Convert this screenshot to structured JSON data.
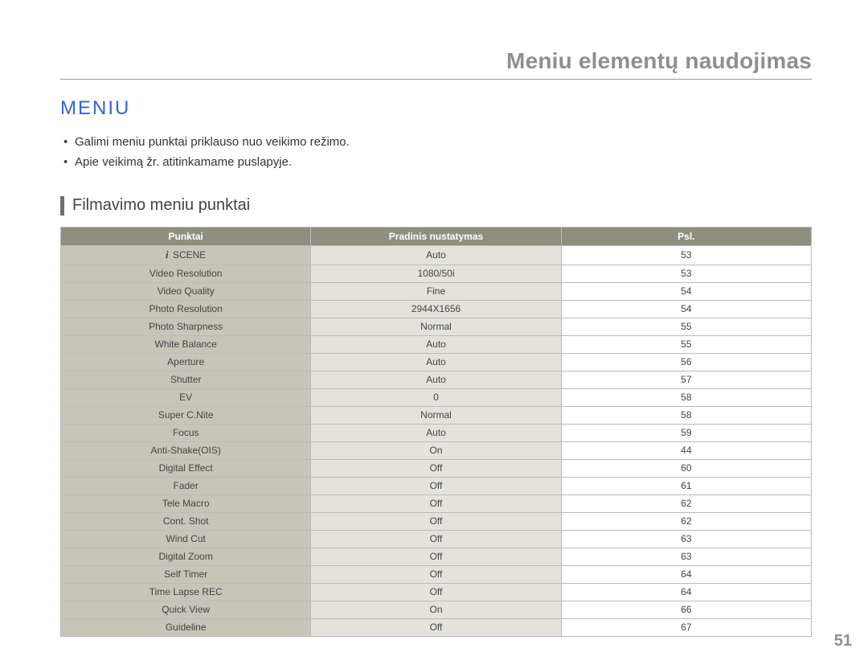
{
  "chapterTitle": "Meniu elementų naudojimas",
  "sectionTitle": "MENIU",
  "bullets": [
    "Galimi meniu punktai priklauso nuo veikimo režimo.",
    "Apie veikimą žr. atitinkamame puslapyje."
  ],
  "subTitle": "Filmavimo meniu punktai",
  "tableHeaders": {
    "col1": "Punktai",
    "col2": "Pradinis nustatymas",
    "col3": "Psl."
  },
  "rows": [
    {
      "name": "SCENE",
      "def": "Auto",
      "pg": "53",
      "scene": true
    },
    {
      "name": "Video Resolution",
      "def": "1080/50i",
      "pg": "53"
    },
    {
      "name": "Video Quality",
      "def": "Fine",
      "pg": "54"
    },
    {
      "name": "Photo Resolution",
      "def": "2944X1656",
      "pg": "54"
    },
    {
      "name": "Photo Sharpness",
      "def": "Normal",
      "pg": "55"
    },
    {
      "name": "White Balance",
      "def": "Auto",
      "pg": "55"
    },
    {
      "name": "Aperture",
      "def": "Auto",
      "pg": "56"
    },
    {
      "name": "Shutter",
      "def": "Auto",
      "pg": "57"
    },
    {
      "name": "EV",
      "def": "0",
      "pg": "58"
    },
    {
      "name": "Super C.Nite",
      "def": "Normal",
      "pg": "58"
    },
    {
      "name": "Focus",
      "def": "Auto",
      "pg": "59"
    },
    {
      "name": "Anti-Shake(OIS)",
      "def": "On",
      "pg": "44"
    },
    {
      "name": "Digital Effect",
      "def": "Off",
      "pg": "60"
    },
    {
      "name": "Fader",
      "def": "Off",
      "pg": "61"
    },
    {
      "name": "Tele Macro",
      "def": "Off",
      "pg": "62"
    },
    {
      "name": "Cont. Shot",
      "def": "Off",
      "pg": "62"
    },
    {
      "name": "Wind Cut",
      "def": "Off",
      "pg": "63"
    },
    {
      "name": "Digital Zoom",
      "def": "Off",
      "pg": "63"
    },
    {
      "name": "Self Timer",
      "def": "Off",
      "pg": "64"
    },
    {
      "name": "Time Lapse REC",
      "def": "Off",
      "pg": "64"
    },
    {
      "name": "Quick View",
      "def": "On",
      "pg": "66"
    },
    {
      "name": "Guideline",
      "def": "Off",
      "pg": "67"
    }
  ],
  "pageNumber": "51"
}
